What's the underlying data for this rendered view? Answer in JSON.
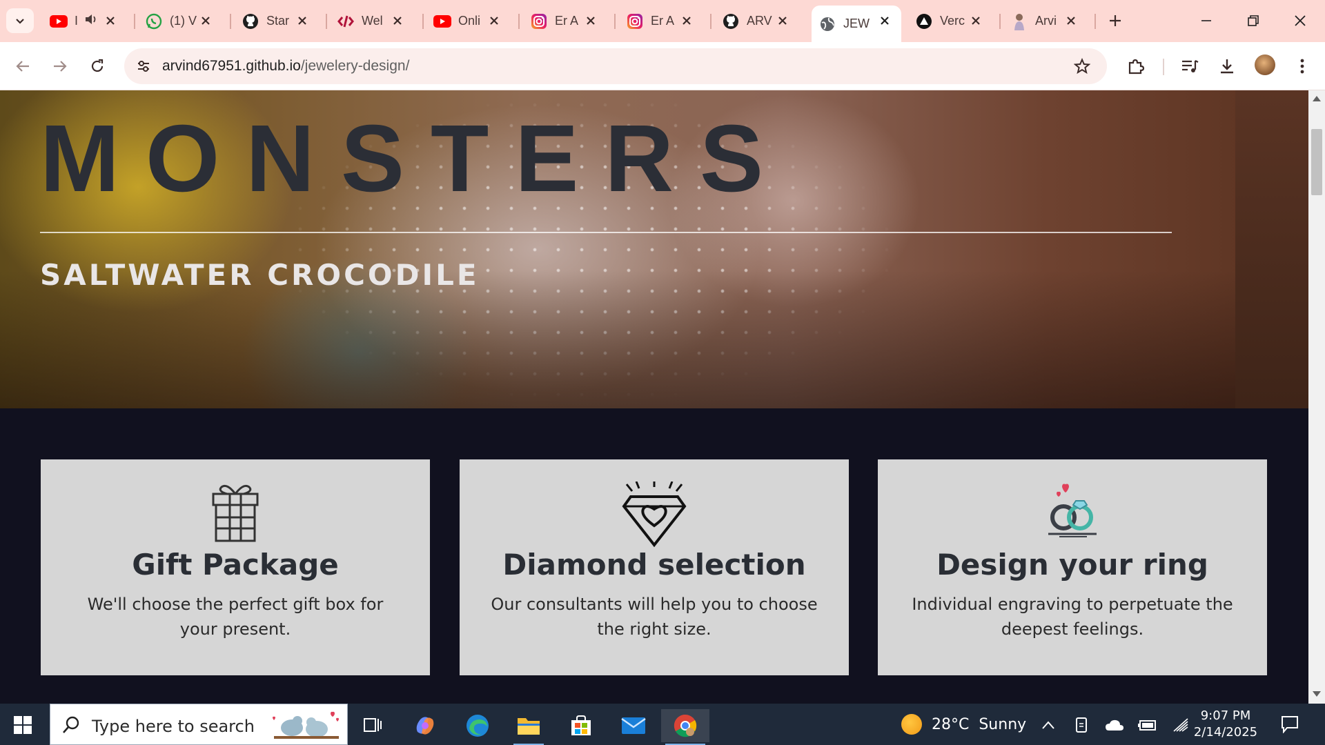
{
  "browser": {
    "tabs": [
      {
        "title": "I",
        "icon": "youtube-icon",
        "audio": true
      },
      {
        "title": "(1) V",
        "icon": "whatsapp-icon"
      },
      {
        "title": "Star",
        "icon": "github-icon"
      },
      {
        "title": "Wel",
        "icon": "code-icon"
      },
      {
        "title": "Onli",
        "icon": "youtube-icon"
      },
      {
        "title": "Er A",
        "icon": "instagram-icon"
      },
      {
        "title": "Er A",
        "icon": "instagram-icon"
      },
      {
        "title": "ARV",
        "icon": "github-icon"
      },
      {
        "title": "JEW",
        "icon": "globe-icon",
        "active": true
      },
      {
        "title": "Verc",
        "icon": "vercel-icon"
      },
      {
        "title": "Arvi",
        "icon": "profile-photo-icon"
      }
    ],
    "address": {
      "host": "arvind67951.github.io",
      "path": "/jewelery-design/"
    }
  },
  "hero": {
    "title": "MONSTERS",
    "subtitle": "SALTWATER CROCODILE"
  },
  "cards": [
    {
      "title": "Gift Package",
      "description": "We'll choose the perfect gift box for your present.",
      "icon": "gift-box-icon"
    },
    {
      "title": "Diamond selection",
      "description": "Our consultants will help you to choose the right size.",
      "icon": "diamond-heart-icon"
    },
    {
      "title": "Design your ring",
      "description": "Individual engraving to perpetuate the deepest feelings.",
      "icon": "rings-icon"
    }
  ],
  "taskbar": {
    "search_placeholder": "Type here to search",
    "weather": "28°C  Sunny",
    "time": "9:07 PM",
    "date": "2/14/2025"
  },
  "colors": {
    "tabstrip": "#fdd9d4",
    "page_background": "#11111f",
    "card_background": "#d6d6d6",
    "taskbar": "#1f2a3a"
  }
}
